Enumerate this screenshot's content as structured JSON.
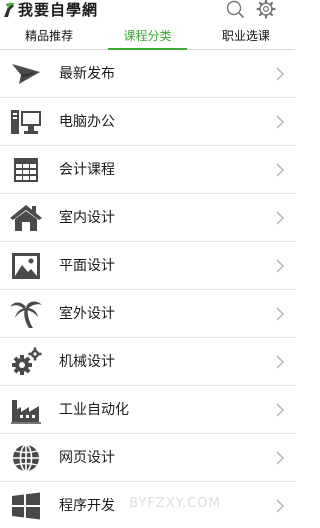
{
  "header": {
    "logo_text": "我要自學網",
    "icons": [
      "search-icon",
      "gear-icon"
    ]
  },
  "tabs": [
    {
      "label": "精品推荐",
      "active": false
    },
    {
      "label": "课程分类",
      "active": true
    },
    {
      "label": "职业选课",
      "active": false
    }
  ],
  "accent_color": "#3aa935",
  "categories": [
    {
      "label": "最新发布",
      "icon": "paper-plane-icon"
    },
    {
      "label": "电脑办公",
      "icon": "computer-icon"
    },
    {
      "label": "会计课程",
      "icon": "spreadsheet-icon"
    },
    {
      "label": "室内设计",
      "icon": "house-icon"
    },
    {
      "label": "平面设计",
      "icon": "picture-icon"
    },
    {
      "label": "室外设计",
      "icon": "palm-tree-icon"
    },
    {
      "label": "机械设计",
      "icon": "gears-icon"
    },
    {
      "label": "工业自动化",
      "icon": "factory-icon"
    },
    {
      "label": "网页设计",
      "icon": "globe-icon"
    },
    {
      "label": "程序开发",
      "icon": "windows-icon"
    }
  ],
  "watermark": "BYFZXY.COM"
}
